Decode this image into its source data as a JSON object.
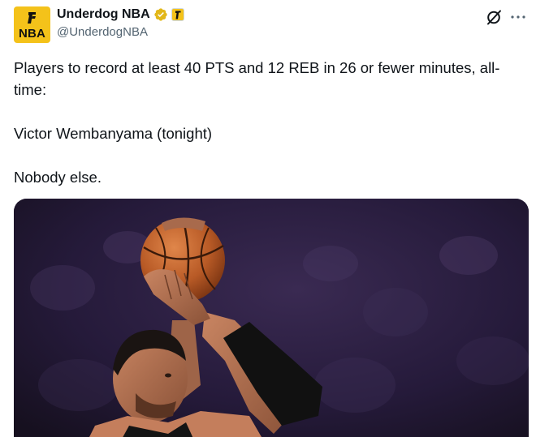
{
  "author": {
    "display_name": "Underdog NBA",
    "handle": "@UnderdogNBA",
    "avatar_text": "NBA",
    "verified_icon": "verified-badge-icon",
    "affiliate_icon": "underdog-affiliate-icon"
  },
  "actions": {
    "grok_icon": "grok-icon",
    "more_icon": "more-icon"
  },
  "tweet": {
    "line1": "Players to record at least 40 PTS and 12 REB in 26 or fewer minutes, all-time:",
    "line2": "Victor Wembanyama (tonight)",
    "line3": "Nobody else."
  },
  "media": {
    "type": "photo",
    "subject": "basketball-player-shooting"
  },
  "colors": {
    "brand_yellow": "#f4c21a",
    "verified_gold": "#e2b719",
    "text_primary": "#0f1419",
    "text_secondary": "#536471"
  }
}
